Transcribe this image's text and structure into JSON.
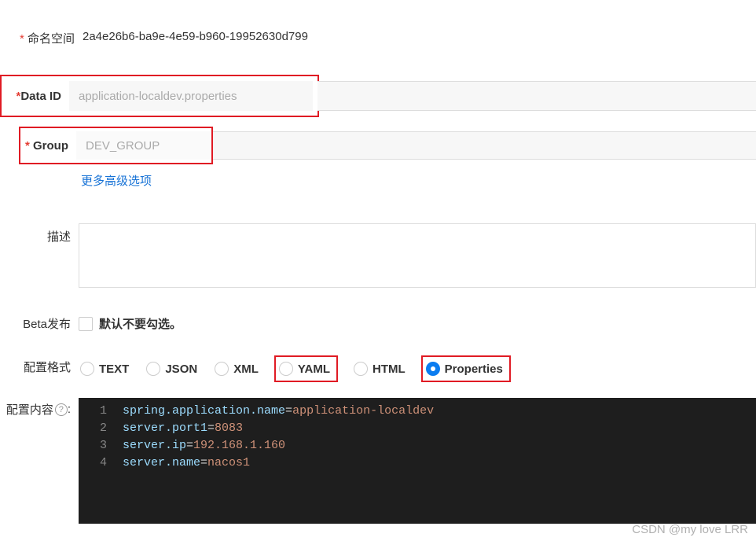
{
  "namespace": {
    "label": "命名空间",
    "value": "2a4e26b6-ba9e-4e59-b960-19952630d799"
  },
  "data_id": {
    "label": "Data ID",
    "value": "application-localdev.properties"
  },
  "group": {
    "label": "Group",
    "value": "DEV_GROUP"
  },
  "advanced_link": "更多高级选项",
  "description": {
    "label": "描述",
    "value": ""
  },
  "beta": {
    "label": "Beta发布",
    "checkbox_label": "默认不要勾选。"
  },
  "format": {
    "label": "配置格式",
    "options": [
      "TEXT",
      "JSON",
      "XML",
      "YAML",
      "HTML",
      "Properties"
    ],
    "selected": "Properties"
  },
  "content": {
    "label": "配置内容",
    "help": "?",
    "colon": ":",
    "lines": [
      {
        "n": "1",
        "key": "spring.application.name",
        "val": "application-localdev"
      },
      {
        "n": "2",
        "key": "server.port1",
        "val": "8083"
      },
      {
        "n": "3",
        "key": "server.ip",
        "val": "192.168.1.160"
      },
      {
        "n": "4",
        "key": "server.name",
        "val": "nacos1"
      }
    ]
  },
  "watermark": "CSDN @my love  LRR"
}
